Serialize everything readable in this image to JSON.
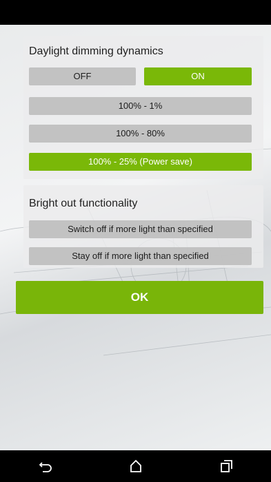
{
  "dimming": {
    "title": "Daylight dimming dynamics",
    "off_label": "OFF",
    "on_label": "ON",
    "state": "ON",
    "options": [
      {
        "label": "100% - 1%",
        "selected": false
      },
      {
        "label": "100% - 80%",
        "selected": false
      },
      {
        "label": "100% - 25% (Power save)",
        "selected": true
      }
    ]
  },
  "bright_out": {
    "title": "Bright out functionality",
    "options": [
      {
        "label": "Switch off if more light than specified",
        "selected": false
      },
      {
        "label": "Stay off if more light than specified",
        "selected": false
      }
    ]
  },
  "ok_label": "OK",
  "colors": {
    "accent": "#7ab808",
    "inactive": "#bebebe"
  },
  "nav_icons": [
    "back-icon",
    "home-icon",
    "recents-icon"
  ]
}
